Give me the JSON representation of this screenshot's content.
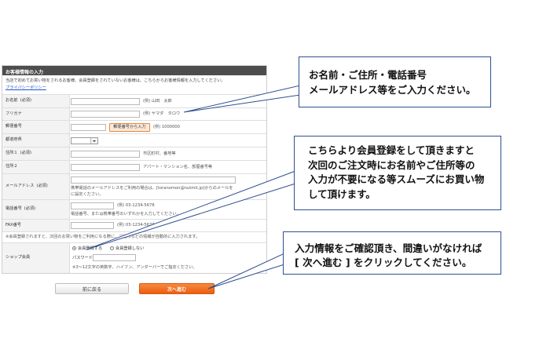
{
  "form": {
    "title": "お客様情報の入力",
    "intro": "当店で初めてお買い物をされるお客様、会員登録をされていないお客様は、こちらからお客様情報を入力してください。",
    "privacy_link": "プライバシーポリシー",
    "rows": {
      "name": {
        "label": "お名前",
        "required": "(必須)",
        "value": "",
        "example": "(例) 山田　太郎"
      },
      "furigana": {
        "label": "フリガナ",
        "value": "",
        "example": "(例) ヤマダ　タロウ"
      },
      "postal": {
        "label": "郵便番号",
        "value": "",
        "button": "郵便番号から入力",
        "example": "(例) 1000000"
      },
      "prefecture": {
        "label": "都道府県",
        "value": ""
      },
      "address1": {
        "label": "住所１",
        "required": "(必須)",
        "value": "",
        "example": "市区町村、番地等"
      },
      "address2": {
        "label": "住所２",
        "value": "",
        "example": "アパート・マンション名、部屋番号等"
      },
      "email": {
        "label": "メールアドレス",
        "required": "(必須)",
        "value": "",
        "note_line1": "携帯電話のメールアドレスをご利用の場合は、[toranomon@nutmit.jp]からのメールを",
        "note_line2": "に設定ください。"
      },
      "tel": {
        "label": "電話番号",
        "required": "(必須)",
        "value": "",
        "example": "(例) 03-1234-5678",
        "note": "電話番号、または携帯番号のいずれかを入力してください。"
      },
      "fax": {
        "label": "FAX番号",
        "value": "",
        "example": "(例) 03-1234-5678"
      }
    },
    "member_note": "※会員登録されますと、次回のお買い物をご利用になる際に、ご住所などの情報が自動的に入力されます。",
    "shop_member": {
      "label": "ショップ会員",
      "option_register": "会員登録する",
      "option_no_register": "会員登録しない",
      "selected": "会員登録する",
      "password_label": "パスワード",
      "password_value": "",
      "password_note": "※3～12文字の英数字、ハイフン、アンダーバーでご指定ください。"
    }
  },
  "buttons": {
    "back": "前に戻る",
    "next": "次へ進む"
  },
  "callouts": {
    "personal_info": {
      "line1": "お名前・ご住所・電話番号",
      "line2": "メールアドレス等をご入力ください。"
    },
    "membership": {
      "line1": "こちらより会員登録をして頂きますと",
      "line2": "次回のご注文時にお名前やご住所等の",
      "line3": "入力が不要になる等スムーズにお買い物",
      "line4": "して頂けます。"
    },
    "next_step": {
      "line1": "入力情報をご確認頂き、間違いがなければ",
      "line2": "[ 次へ進む ] をクリックしてください。"
    }
  },
  "colors": {
    "header_bg": "#4d4d4d",
    "label_bg": "#f3f3f3",
    "required": "#e00000",
    "link": "#2255cc",
    "next_button": "#ec5e12",
    "callout_border": "#2f4f8f"
  }
}
